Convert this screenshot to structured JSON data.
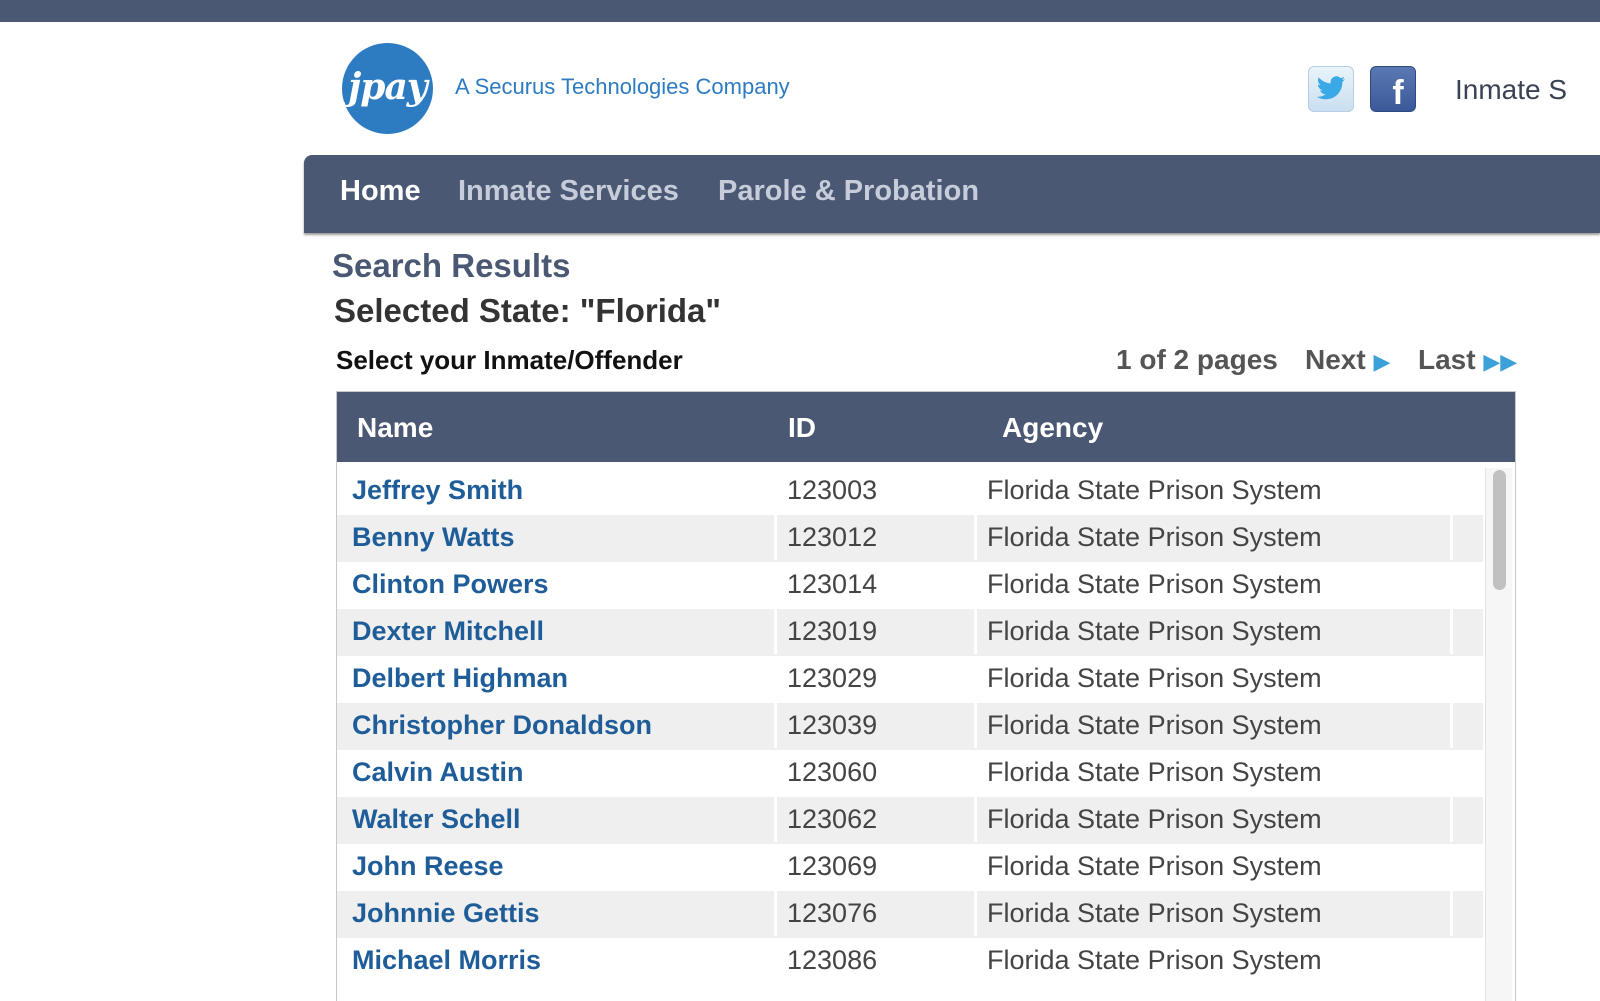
{
  "header": {
    "logo_text": "jpay",
    "tagline": "A Securus Technologies Company",
    "social": {
      "twitter_icon": "twitter-icon",
      "facebook_icon": "facebook-icon",
      "facebook_glyph": "f"
    },
    "right_link": "Inmate S"
  },
  "nav": {
    "home": "Home",
    "inmate_services": "Inmate Services",
    "parole_probation": "Parole & Probation"
  },
  "page": {
    "title": "Search Results",
    "subtitle": "Selected State: \"Florida\"",
    "instruction": "Select your Inmate/Offender"
  },
  "pager": {
    "count": "1 of 2 pages",
    "next": "Next",
    "last": "Last",
    "next_arrow": "▶",
    "last_arrow": "▶▶"
  },
  "table": {
    "columns": {
      "name": "Name",
      "id": "ID",
      "agency": "Agency"
    },
    "rows": [
      {
        "name": "Jeffrey Smith",
        "id": "123003",
        "agency": "Florida State Prison System"
      },
      {
        "name": "Benny Watts",
        "id": "123012",
        "agency": "Florida State Prison System"
      },
      {
        "name": "Clinton Powers",
        "id": "123014",
        "agency": "Florida State Prison System"
      },
      {
        "name": "Dexter Mitchell",
        "id": "123019",
        "agency": "Florida State Prison System"
      },
      {
        "name": "Delbert Highman",
        "id": "123029",
        "agency": "Florida State Prison System"
      },
      {
        "name": "Christopher Donaldson",
        "id": "123039",
        "agency": "Florida State Prison System"
      },
      {
        "name": "Calvin Austin",
        "id": "123060",
        "agency": "Florida State Prison System"
      },
      {
        "name": "Walter Schell",
        "id": "123062",
        "agency": "Florida State Prison System"
      },
      {
        "name": "John Reese",
        "id": "123069",
        "agency": "Florida State Prison System"
      },
      {
        "name": "Johnnie Gettis",
        "id": "123076",
        "agency": "Florida State Prison System"
      },
      {
        "name": "Michael Morris",
        "id": "123086",
        "agency": "Florida State Prison System"
      }
    ]
  },
  "colors": {
    "nav_bg": "#4b5873",
    "brand_blue": "#2d7cc1",
    "link_blue": "#1f5d99",
    "pager_arrow": "#3ca0d9"
  }
}
